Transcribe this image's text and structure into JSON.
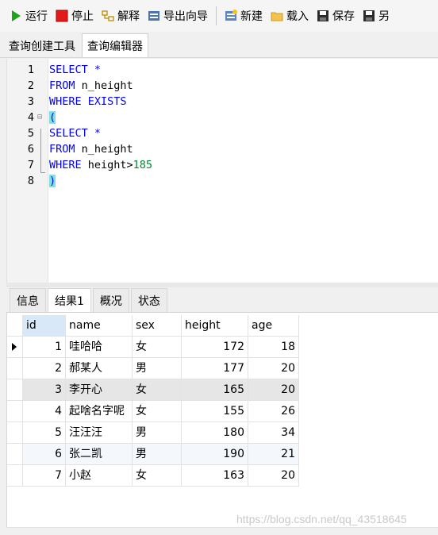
{
  "toolbar": {
    "run": "运行",
    "stop": "停止",
    "explain": "解释",
    "export_wizard": "导出向导",
    "new": "新建",
    "load": "载入",
    "save": "保存",
    "save_as": "另"
  },
  "editor_tabs": [
    "查询创建工具",
    "查询编辑器"
  ],
  "code": {
    "line_numbers": [
      "1",
      "2",
      "3",
      "4",
      "5",
      "6",
      "7",
      "8"
    ],
    "l1": "SELECT *",
    "l2_kw": "FROM",
    "l2_rest": " n_height",
    "l3": "WHERE EXISTS",
    "l4": "(",
    "l5": "SELECT *",
    "l6_kw": "FROM",
    "l6_rest": " n_height",
    "l7_kw": "WHERE",
    "l7_rest": " height>",
    "l7_num": "185",
    "l8": ")"
  },
  "result_tabs": [
    "信息",
    "结果1",
    "概况",
    "状态"
  ],
  "grid": {
    "columns": [
      "id",
      "name",
      "sex",
      "height",
      "age"
    ],
    "rows": [
      [
        "1",
        "哇哈哈",
        "女",
        "172",
        "18"
      ],
      [
        "2",
        "郝某人",
        "男",
        "177",
        "20"
      ],
      [
        "3",
        "李开心",
        "女",
        "165",
        "20"
      ],
      [
        "4",
        "起啥名字呢",
        "女",
        "155",
        "26"
      ],
      [
        "5",
        "汪汪汪",
        "男",
        "180",
        "34"
      ],
      [
        "6",
        "张二凯",
        "男",
        "190",
        "21"
      ],
      [
        "7",
        "小赵",
        "女",
        "163",
        "20"
      ]
    ]
  },
  "watermark": "https://blog.csdn.net/qq_43518645",
  "colors": {
    "keyword": "#0000ff",
    "number": "#008a2e",
    "selected_header": "#d8e8f8"
  },
  "icons": [
    "run-icon",
    "stop-icon",
    "explain-icon",
    "export-wizard-icon",
    "new-icon",
    "load-icon",
    "save-icon",
    "save-as-icon"
  ]
}
